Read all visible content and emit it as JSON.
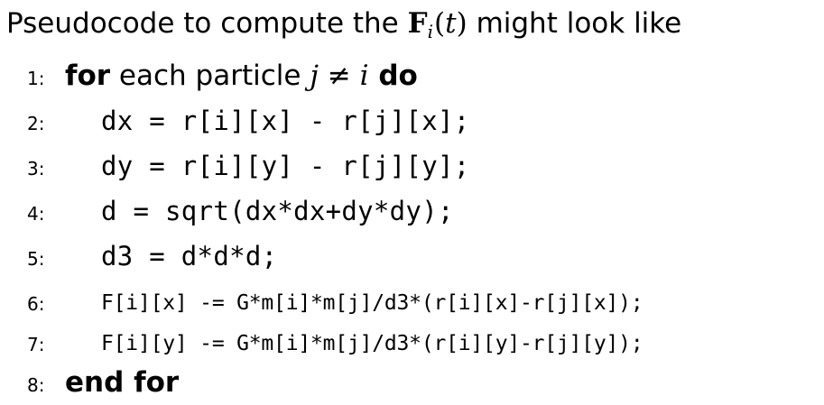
{
  "intro": {
    "before": "Pseudocode to compute the ",
    "math_F": "F",
    "math_sub": "i",
    "math_open": "(",
    "math_t": "t",
    "math_close": ")",
    "after": " might look like"
  },
  "lines": [
    {
      "num": "1:",
      "kw1": "for",
      "text": " each particle ",
      "math_j": "j",
      "math_neq": " ≠ ",
      "math_i": "i",
      "kw2": " do"
    },
    {
      "num": "2:",
      "code": "dx = r[i][x] - r[j][x];"
    },
    {
      "num": "3:",
      "code": "dy = r[i][y] - r[j][y];"
    },
    {
      "num": "4:",
      "code": "d = sqrt(dx*dx+dy*dy);"
    },
    {
      "num": "5:",
      "code": "d3 = d*d*d;"
    },
    {
      "num": "6:",
      "code": "F[i][x] -= G*m[i]*m[j]/d3*(r[i][x]-r[j][x]);"
    },
    {
      "num": "7:",
      "code": "F[i][y] -= G*m[i]*m[j]/d3*(r[i][y]-r[j][y]);"
    },
    {
      "num": "8:",
      "kw": "end for"
    }
  ]
}
